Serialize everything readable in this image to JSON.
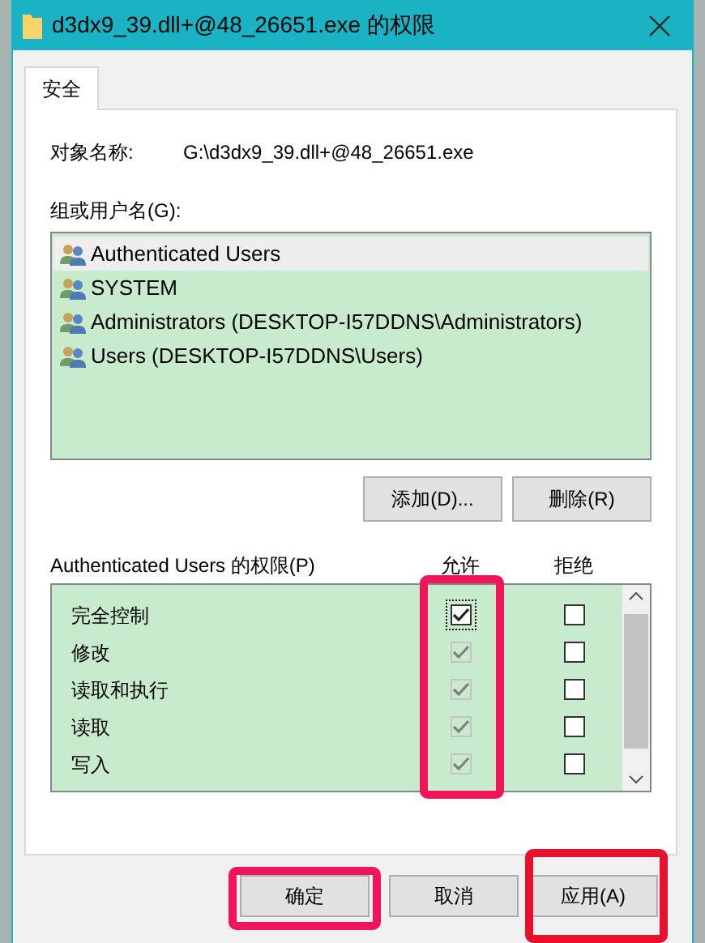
{
  "window": {
    "title": "d3dx9_39.dll+@48_26651.exe 的权限"
  },
  "tabs": [
    {
      "label": "安全",
      "selected": true
    }
  ],
  "object_name": {
    "label": "对象名称:",
    "value": "G:\\d3dx9_39.dll+@48_26651.exe"
  },
  "groups": {
    "label": "组或用户名(G):",
    "items": [
      {
        "name": "Authenticated Users",
        "selected": true
      },
      {
        "name": "SYSTEM",
        "selected": false
      },
      {
        "name": "Administrators (DESKTOP-I57DDNS\\Administrators)",
        "selected": false
      },
      {
        "name": "Users (DESKTOP-I57DDNS\\Users)",
        "selected": false
      }
    ]
  },
  "group_buttons": [
    "添加(D)...",
    "删除(R)"
  ],
  "permissions": {
    "label": "Authenticated Users 的权限(P)",
    "allow_header": "允许",
    "deny_header": "拒绝",
    "allow_highlighted": true,
    "rows": [
      {
        "name": "完全控制",
        "allow": {
          "checked": true,
          "disabled": false,
          "focused": true
        },
        "deny": {
          "checked": false,
          "disabled": false
        }
      },
      {
        "name": "修改",
        "allow": {
          "checked": true,
          "disabled": true
        },
        "deny": {
          "checked": false,
          "disabled": false
        }
      },
      {
        "name": "读取和执行",
        "allow": {
          "checked": true,
          "disabled": true
        },
        "deny": {
          "checked": false,
          "disabled": false
        }
      },
      {
        "name": "读取",
        "allow": {
          "checked": true,
          "disabled": true
        },
        "deny": {
          "checked": false,
          "disabled": false
        }
      },
      {
        "name": "写入",
        "allow": {
          "checked": true,
          "disabled": true
        },
        "deny": {
          "checked": false,
          "disabled": false
        }
      }
    ]
  },
  "buttons": [
    {
      "label": "确定",
      "highlighted": true
    },
    {
      "label": "取消",
      "highlighted": false
    },
    {
      "label": "应用(A)",
      "highlighted": true
    }
  ]
}
